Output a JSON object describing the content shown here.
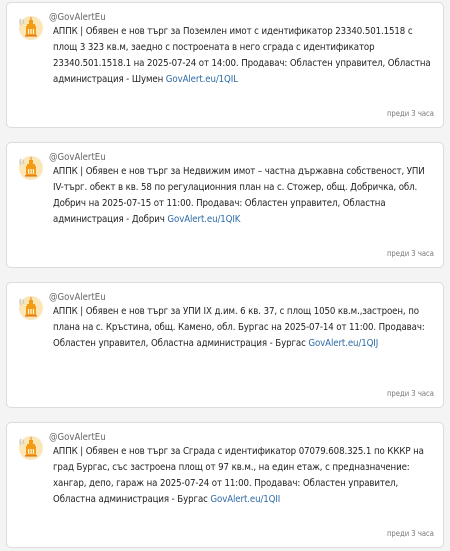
{
  "posts": [
    {
      "handle": "@GovAlertEu",
      "text": "АППК | Обявен е нов търг за Поземлен имот с идентификатор 23340.501.1518 с площ 3 323 кв.м, заедно с построената в него сграда с идентификатор 23340.501.1518.1 на 2025-07-24 от 14:00. Продавач: Областен управител, Областна администрация - Шумен ",
      "link": "GovAlert.eu/1QIL",
      "time": "преди 3 часа"
    },
    {
      "handle": "@GovAlertEu",
      "text": "АППК | Обявен е нов търг за Недвижим имот – частна държавна собственост, УПИ IV-търг. обект в кв. 58 по регулационния план на с. Стожер, общ. Добричка, обл. Добрич на 2025-07-15 от 11:00. Продавач: Областен управител, Областна администрация - Добрич ",
      "link": "GovAlert.eu/1QIK",
      "time": "преди 3 часа"
    },
    {
      "handle": "@GovAlertEu",
      "text": "АППК | Обявен е нов търг за УПИ IX д.им. 6 кв. 37, с площ 1050 кв.м.,застроен, по плана на с. Кръстина, общ. Камено, обл. Бургас на 2025-07-14 от 11:00. Продавач: Областен управител, Областна администрация - Бургас ",
      "link": "GovAlert.eu/1QIJ",
      "time": "преди 3 часа"
    },
    {
      "handle": "@GovAlertEu",
      "text": "АППК | Обявен е нов търг за Сграда с идентификатор 07079.608.325.1 по КККР на град Бургас, със застроена площ от 97 кв.м., на един етаж, с предназначение: хангар, депо, гараж на 2025-07-24 от 11:00. Продавач: Областен управител, Областна администрация - Бургас ",
      "link": "GovAlert.eu/1QII",
      "time": "преди 3 часа"
    }
  ],
  "colors": {
    "link": "#2d6aa6",
    "avatar_orange": "#f39c12",
    "avatar_cream": "#fbe6b8"
  },
  "icons": {
    "avatar": "govalert-logo-icon"
  }
}
